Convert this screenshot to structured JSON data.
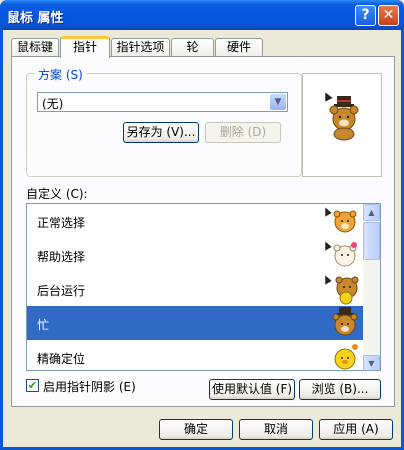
{
  "window": {
    "title": "鼠标 属性",
    "help_label": "?",
    "close_label": "✕"
  },
  "tabs": [
    {
      "label": "鼠标键",
      "active": false
    },
    {
      "label": "指针",
      "active": true
    },
    {
      "label": "指针选项",
      "active": false
    },
    {
      "label": "轮",
      "active": false
    },
    {
      "label": "硬件",
      "active": false
    }
  ],
  "scheme": {
    "label": "方案 (S)",
    "selected": "(无)",
    "save_as_label": "另存为 (V)...",
    "delete_label": "删除 (D)"
  },
  "preview": {
    "icon": "busy-bear-cursor-icon"
  },
  "customize": {
    "label": "自定义 (C):",
    "items": [
      {
        "label": "正常选择",
        "icon": "bear-arrow-icon"
      },
      {
        "label": "帮助选择",
        "icon": "bear-help-icon"
      },
      {
        "label": "后台运行",
        "icon": "bear-working-icon"
      },
      {
        "label": "忙",
        "icon": "bear-busy-icon"
      },
      {
        "label": "精确定位",
        "icon": "bear-precision-icon"
      }
    ],
    "selected_index": 3
  },
  "shadow": {
    "label": "启用指针阴影 (E)",
    "checked": true
  },
  "actions": {
    "use_default_label": "使用默认值 (F)",
    "browse_label": "浏览 (B)..."
  },
  "footer": {
    "ok_label": "确定",
    "cancel_label": "取消",
    "apply_label": "应用 (A)"
  },
  "colors": {
    "titlebar": "#0a55d8",
    "selection": "#316ac5",
    "dialog_bg": "#ece9d8",
    "tab_highlight": "#ffc83c"
  }
}
